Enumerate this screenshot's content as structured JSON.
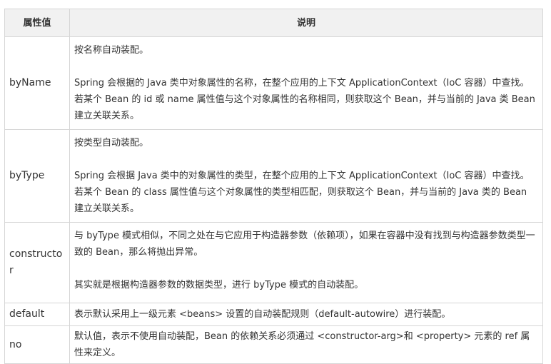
{
  "table": {
    "headers": {
      "attr": "属性值",
      "desc": "说明"
    },
    "rows": [
      {
        "key": "byName",
        "p1": "按名称自动装配。",
        "p2": "Spring 会根据的 Java 类中对象属性的名称，在整个应用的上下文 ApplicationContext（IoC 容器）中查找。若某个 Bean 的 id 或 name 属性值与这个对象属性的名称相同，则获取这个 Bean，并与当前的 Java 类 Bean 建立关联关系。"
      },
      {
        "key": "byType",
        "p1": "按类型自动装配。",
        "p2": "Spring 会根据 Java 类中的对象属性的类型，在整个应用的上下文 ApplicationContext（IoC 容器）中查找。若某个 Bean 的 class 属性值与这个对象属性的类型相匹配，则获取这个 Bean，并与当前的 Java 类的 Bean 建立关联关系。"
      },
      {
        "key": "constructor",
        "p1": "与 byType 模式相似，不同之处在与它应用于构造器参数（依赖项），如果在容器中没有找到与构造器参数类型一致的 Bean，那么将抛出异常。",
        "p2": "其实就是根据构造器参数的数据类型，进行 byType 模式的自动装配。"
      },
      {
        "key": "default",
        "p1": "表示默认采用上一级元素 <beans> 设置的自动装配规则（default-autowire）进行装配。"
      },
      {
        "key": "no",
        "p1": "默认值，表示不使用自动装配，Bean 的依赖关系必须通过 <constructor-arg>和 <property> 元素的 ref 属性来定义。"
      }
    ]
  }
}
